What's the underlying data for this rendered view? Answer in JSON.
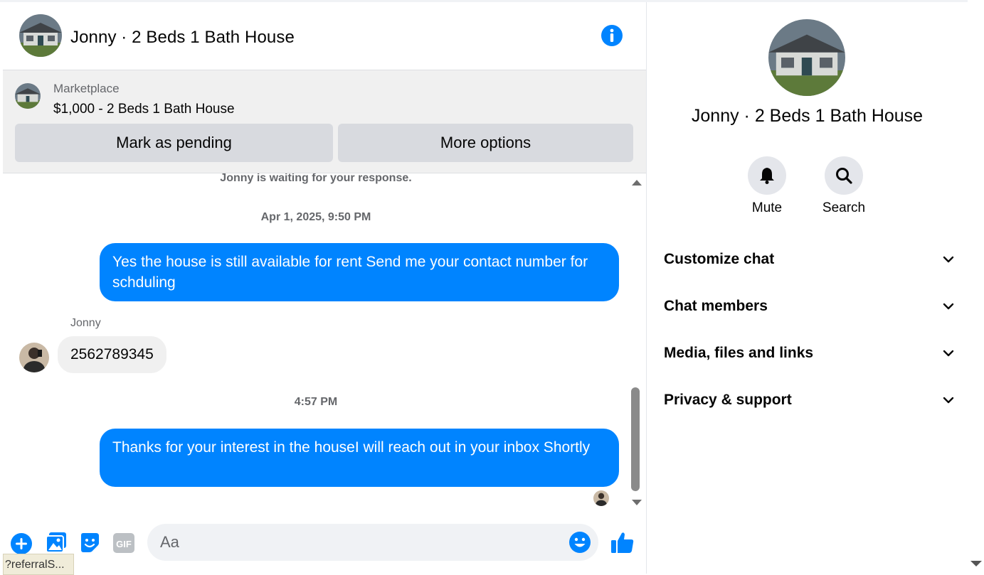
{
  "header": {
    "title": "Jonny · 2 Beds 1 Bath House"
  },
  "marketplace": {
    "label": "Marketplace",
    "listing": "$1,000 - 2 Beds 1 Bath House",
    "pending_label": "Mark as pending",
    "more_label": "More options"
  },
  "messages": {
    "waiting": "Jonny is waiting for your response.",
    "timestamp1": "Apr 1, 2025, 9:50 PM",
    "out1": "Yes the house is still available for rent Send me your contact number for schduling",
    "sender": "Jonny",
    "in1": "2562789345",
    "timestamp2": "4:57 PM",
    "out2": "Thanks for your interest in the houseI will reach out  in your inbox Shortly"
  },
  "composer": {
    "placeholder": "Aa"
  },
  "status_tip": "?referralS...",
  "details": {
    "title": "Jonny · 2 Beds 1 Bath House",
    "mute_label": "Mute",
    "search_label": "Search",
    "sections": [
      "Customize chat",
      "Chat members",
      "Media, files and links",
      "Privacy & support"
    ]
  },
  "colors": {
    "accent": "#0084ff",
    "bubble_in": "#f0f0f0",
    "button_gray": "#d8dadf",
    "muted_text": "#65676b"
  }
}
